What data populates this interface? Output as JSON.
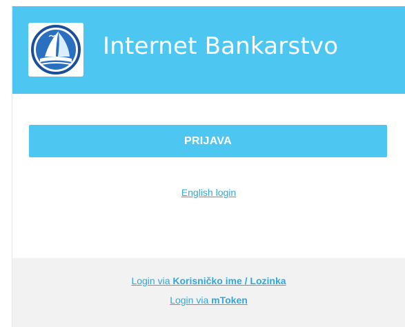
{
  "header": {
    "title": "Internet Bankarstvo",
    "logo_icon": "sailboat-logo-icon",
    "background_color": "#4dc6f2"
  },
  "main": {
    "login_button_label": "PRIJAVA",
    "english_login_label": "English login",
    "accent_color": "#4dc6f2",
    "link_color": "#2fa8dc"
  },
  "footer": {
    "links": [
      {
        "prefix": "Login via ",
        "method": "Korisničko ime / Lozinka"
      },
      {
        "prefix": "Login via ",
        "method": "mToken"
      }
    ],
    "background_color": "#f2f2f2"
  }
}
